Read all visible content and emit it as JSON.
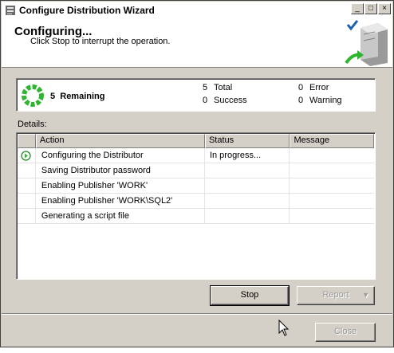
{
  "window": {
    "title": "Configure Distribution Wizard",
    "controls": {
      "minimize": "_",
      "maximize": "□",
      "close": "×"
    }
  },
  "header": {
    "title": "Configuring...",
    "subtitle": "Click Stop to interrupt the operation."
  },
  "summary": {
    "remaining_count": "5",
    "remaining_label": "Remaining",
    "total_count": "5",
    "total_label": "Total",
    "success_count": "0",
    "success_label": "Success",
    "error_count": "0",
    "error_label": "Error",
    "warning_count": "0",
    "warning_label": "Warning"
  },
  "details": {
    "label": "Details:",
    "columns": [
      "Action",
      "Status",
      "Message"
    ],
    "rows": [
      {
        "action": "Configuring the Distributor",
        "status": "In progress...",
        "message": "",
        "icon": "in-progress-arrow-icon"
      },
      {
        "action": "Saving Distributor password",
        "status": "",
        "message": "",
        "icon": ""
      },
      {
        "action": "Enabling Publisher 'WORK'",
        "status": "",
        "message": "",
        "icon": ""
      },
      {
        "action": "Enabling Publisher 'WORK\\SQL2'",
        "status": "",
        "message": "",
        "icon": ""
      },
      {
        "action": "Generating a script file",
        "status": "",
        "message": "",
        "icon": ""
      }
    ]
  },
  "buttons": {
    "stop": "Stop",
    "report": "Report",
    "close": "Close"
  },
  "colors": {
    "accent_green": "#2fb52f",
    "title_bg": "#ffffff",
    "dialog_bg": "#d4d0c8"
  }
}
